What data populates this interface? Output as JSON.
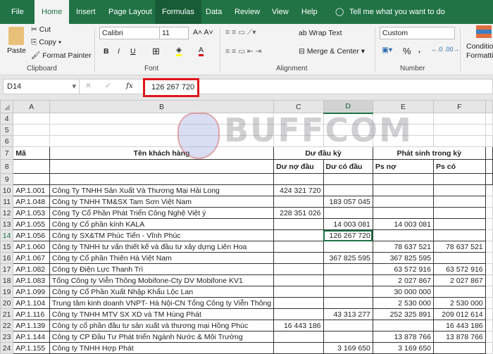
{
  "tabs": [
    "File",
    "Home",
    "Insert",
    "Page Layout",
    "Formulas",
    "Data",
    "Review",
    "View",
    "Help"
  ],
  "tell_me": "Tell me what you want to do",
  "clipboard": {
    "paste": "Paste",
    "cut": "Cut",
    "copy": "Copy",
    "format_painter": "Format Painter",
    "label": "Clipboard"
  },
  "font": {
    "name": "Calibri",
    "size": "11",
    "bold": "B",
    "italic": "I",
    "underline": "U",
    "label": "Font",
    "font_color": "A"
  },
  "alignment": {
    "wrap": "Wrap Text",
    "merge": "Merge & Center",
    "label": "Alignment"
  },
  "number": {
    "format": "Custom",
    "percent": "%",
    "comma": ",",
    "label": "Number"
  },
  "styles": {
    "conditional": "Conditional Formatting"
  },
  "formula_bar": {
    "name_box": "D14",
    "fx": "fx",
    "value": "126 267 720"
  },
  "watermark": "BUFFCOM",
  "columns": [
    "A",
    "B",
    "C",
    "D",
    "E",
    "F"
  ],
  "headers": {
    "ma": "Mã",
    "ten": "Tên khách hàng",
    "du_dau_ky": "Dư đầu kỳ",
    "phat_sinh": "Phát sinh trong kỳ",
    "du_no": "Dư nợ đầu",
    "du_co": "Dư có đầu",
    "ps_no": "Ps nợ",
    "ps_co": "Ps có"
  },
  "rows": [
    {
      "n": "10",
      "a": "AP.1.001",
      "b": "Công Ty TNHH Sản Xuất Và Thương Mại Hải Long",
      "c": "424 321 720",
      "d": "",
      "e": "",
      "f": ""
    },
    {
      "n": "11",
      "a": "AP.1.048",
      "b": "Công ty TNHH TM&SX Tam Sơn Việt Nam",
      "c": "",
      "d": "183 057 045",
      "e": "",
      "f": ""
    },
    {
      "n": "12",
      "a": "AP.1.053",
      "b": "Công Ty Cổ Phần Phát Triển Công Nghệ Việt ý",
      "c": "228 351 026",
      "d": "",
      "e": "",
      "f": ""
    },
    {
      "n": "13",
      "a": "AP.1.055",
      "b": "Công ty Cổ phần kính KALA",
      "c": "",
      "d": "14 003 081",
      "e": "14 003 081",
      "f": ""
    },
    {
      "n": "14",
      "a": "AP.1.056",
      "b": "Công ty SX&TM Phúc Tiến - Vĩnh Phúc",
      "c": "",
      "d": "126 267 720",
      "e": "",
      "f": ""
    },
    {
      "n": "15",
      "a": "AP.1.060",
      "b": "Công ty TNHH tư vấn thiết kế và đầu tư xây dựng Liên Hoa",
      "c": "",
      "d": "",
      "e": "78 637 521",
      "f": "78 637 521"
    },
    {
      "n": "16",
      "a": "AP.1.067",
      "b": "Công ty Cổ phần Thiên Hà Việt Nam",
      "c": "",
      "d": "367 825 595",
      "e": "367 825 595",
      "f": ""
    },
    {
      "n": "17",
      "a": "AP.1.082",
      "b": "Công ty Điện Lực Thanh Trì",
      "c": "",
      "d": "",
      "e": "63 572 916",
      "f": "63 572 916"
    },
    {
      "n": "18",
      "a": "AP.1.083",
      "b": "Tổng Công ty Viễn Thông Mobifone-Cty DV Mobifone KV1",
      "c": "",
      "d": "",
      "e": "2 027 867",
      "f": "2 027 867"
    },
    {
      "n": "19",
      "a": "AP.1.099",
      "b": "Công ty Cổ Phần Xuất Nhập Khẩu Lộc Lan",
      "c": "",
      "d": "",
      "e": "30 000 000",
      "f": ""
    },
    {
      "n": "20",
      "a": "AP.1.104",
      "b": "Trung tâm kinh doanh VNPT- Hà Nội-CN Tổng Công ty Viễn Thông",
      "c": "",
      "d": "",
      "e": "2 530 000",
      "f": "2 530 000"
    },
    {
      "n": "21",
      "a": "AP.1.116",
      "b": "Công ty TNHH MTV SX XD và TM Hùng Phát",
      "c": "",
      "d": "43 313 277",
      "e": "252 325 891",
      "f": "209 012 614"
    },
    {
      "n": "22",
      "a": "AP.1.139",
      "b": "Công ty cổ phần đầu tư sản xuất và thương mại Hồng Phúc",
      "c": "16 443 186",
      "d": "",
      "e": "",
      "f": "16 443 186"
    },
    {
      "n": "23",
      "a": "AP.1.144",
      "b": "Công ty CP Đầu Tư Phát triển Ngành Nước & Môi Trường",
      "c": "",
      "d": "",
      "e": "13 878 766",
      "f": "13 878 766"
    },
    {
      "n": "24",
      "a": "AP.1.155",
      "b": "Công ty TNHH Hợp Phát",
      "c": "",
      "d": "3 169 650",
      "e": "3 169 650",
      "f": ""
    }
  ]
}
